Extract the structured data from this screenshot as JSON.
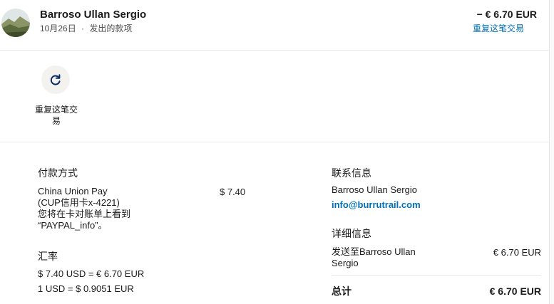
{
  "header": {
    "merchant_name": "Barroso Ullan Sergio",
    "date": "10月26日",
    "separator": "·",
    "transaction_type": "发出的款项",
    "amount": "− € 6.70 EUR",
    "repeat_link": "重复这笔交易"
  },
  "actions": {
    "repeat_icon": "refresh-icon",
    "repeat_label_line1": "重复这笔交",
    "repeat_label_line2": "易"
  },
  "payment": {
    "title": "付款方式",
    "method_line1": "China Union Pay",
    "method_line2": "(CUP信用卡x-4221)",
    "method_line3": "您将在卡对账单上看到",
    "method_line4": "“PAYPAL_info”。",
    "amount": "$ 7.40"
  },
  "exchange": {
    "title": "汇率",
    "line1": "$ 7.40 USD = € 6.70 EUR",
    "line2": "1 USD = $ 0.9051 EUR"
  },
  "contact": {
    "title": "联系信息",
    "name": "Barroso Ullan Sergio",
    "email": "info@burrutrail.com"
  },
  "details": {
    "title": "详细信息",
    "sent_to_line1": "发送至Barroso Ullan",
    "sent_to_line2": "Sergio",
    "sent_amount": "€ 6.70 EUR",
    "total_label": "总计",
    "total_amount": "€ 6.70 EUR"
  },
  "colors": {
    "link": "#0070ba",
    "text": "#1a1a1a",
    "divider": "#e8e8e8",
    "button_bg": "#f3f2ef"
  }
}
